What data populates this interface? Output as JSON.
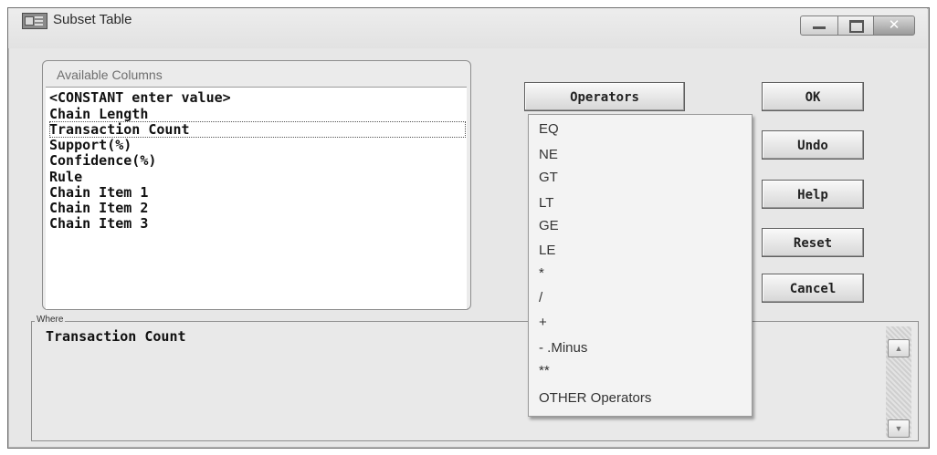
{
  "window": {
    "title": "Subset Table"
  },
  "available_columns": {
    "label": "Available Columns",
    "items": [
      "<CONSTANT enter value>",
      "Chain Length",
      "Transaction Count",
      "Support(%)",
      "Confidence(%)",
      "Rule",
      "Chain Item 1",
      "Chain Item 2",
      "Chain Item 3"
    ],
    "focused_item": "Transaction Count"
  },
  "where": {
    "label": "Where",
    "value": "Transaction Count"
  },
  "operators": {
    "button_label": "Operators",
    "menu_items": [
      "EQ",
      "NE",
      "GT",
      "LT",
      "GE",
      "LE",
      "*",
      "/",
      "+",
      "- .Minus",
      "**",
      "OTHER Operators"
    ]
  },
  "buttons": {
    "ok": "OK",
    "undo": "Undo",
    "help": "Help",
    "reset": "Reset",
    "cancel": "Cancel"
  },
  "scrollbar": {
    "up": "▲",
    "down": "▼"
  },
  "window_controls": {
    "close": "✕"
  },
  "icons": [
    "app-table-icon",
    "minimize-icon",
    "maximize-icon",
    "close-icon"
  ]
}
